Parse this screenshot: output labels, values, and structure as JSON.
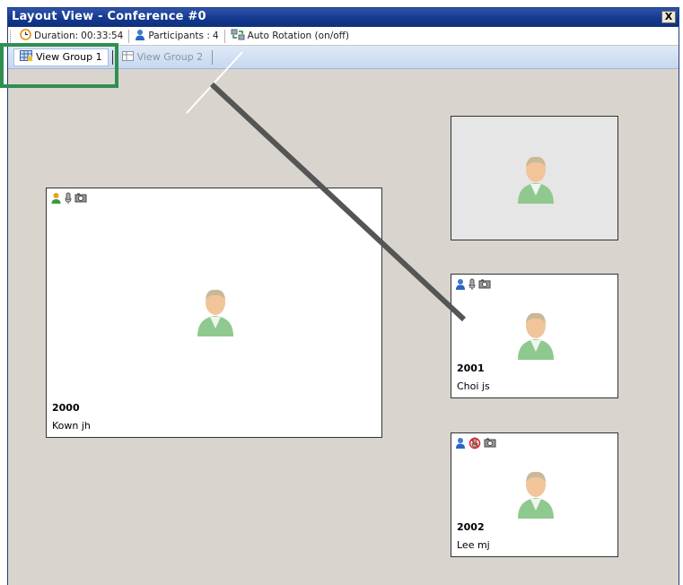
{
  "window": {
    "title": "Layout View - Conference #0",
    "close_label": "X"
  },
  "toolbar": {
    "duration_label": "Duration:",
    "duration_value": "00:33:54",
    "participants_label": "Participants :",
    "participants_value": "4",
    "auto_rotation_label": "Auto Rotation (on/off)"
  },
  "tabs": [
    {
      "label": "View Group 1",
      "active": true
    },
    {
      "label": "View Group 2",
      "active": false
    }
  ],
  "tiles": [
    {
      "id": "2000",
      "name": "Kown jh",
      "status": "speaking"
    },
    {
      "id": "",
      "name": "",
      "status": "empty"
    },
    {
      "id": "2001",
      "name": "Choi js",
      "status": "normal"
    },
    {
      "id": "2002",
      "name": "Lee mj",
      "status": "mic-muted"
    }
  ],
  "colors": {
    "title_bar": "#143a8f",
    "highlight": "#2f8f4e",
    "background": "#d9d5ce"
  }
}
